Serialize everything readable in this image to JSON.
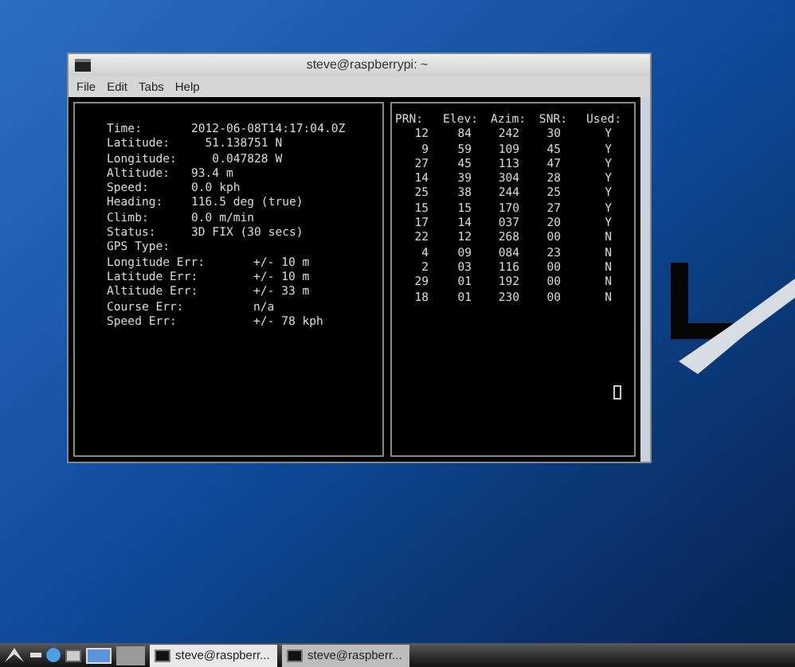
{
  "window": {
    "title": "steve@raspberrypi: ~"
  },
  "menu": [
    "File",
    "Edit",
    "Tabs",
    "Help"
  ],
  "fix": [
    {
      "label": "Time:",
      "value": "2012-06-08T14:17:04.0Z"
    },
    {
      "label": "Latitude:",
      "value": "  51.138751 N"
    },
    {
      "label": "Longitude:",
      "value": "   0.047828 W"
    },
    {
      "label": "Altitude:",
      "value": "93.4 m"
    },
    {
      "label": "Speed:",
      "value": "0.0 kph"
    },
    {
      "label": "Heading:",
      "value": "116.5 deg (true)"
    },
    {
      "label": "Climb:",
      "value": "0.0 m/min"
    },
    {
      "label": "Status:",
      "value": "3D FIX (30 secs)"
    },
    {
      "label": "GPS Type:"
    }
  ],
  "errors": [
    {
      "label": "Longitude Err:",
      "value": "+/- 10 m"
    },
    {
      "label": "Latitude Err:",
      "value": "+/- 10 m"
    },
    {
      "label": "Altitude Err:",
      "value": "+/- 33 m"
    },
    {
      "label": "Course Err:",
      "value": "n/a"
    },
    {
      "label": "Speed Err:",
      "value": "+/- 78 kph"
    }
  ],
  "satellites": {
    "columns": [
      "PRN:",
      "Elev:",
      "Azim:",
      "SNR:",
      "Used:"
    ],
    "rows": [
      [
        "12",
        "84",
        "242",
        "30",
        "Y"
      ],
      [
        "9",
        "59",
        "109",
        "45",
        "Y"
      ],
      [
        "27",
        "45",
        "113",
        "47",
        "Y"
      ],
      [
        "14",
        "39",
        "304",
        "28",
        "Y"
      ],
      [
        "25",
        "38",
        "244",
        "25",
        "Y"
      ],
      [
        "15",
        "15",
        "170",
        "27",
        "Y"
      ],
      [
        "17",
        "14",
        "037",
        "20",
        "Y"
      ],
      [
        "22",
        "12",
        "268",
        "00",
        "N"
      ],
      [
        "4",
        "09",
        "084",
        "23",
        "N"
      ],
      [
        "2",
        "03",
        "116",
        "00",
        "N"
      ],
      [
        "29",
        "01",
        "192",
        "00",
        "N"
      ],
      [
        "18",
        "01",
        "230",
        "00",
        "N"
      ]
    ]
  },
  "taskbar": {
    "tasks": [
      {
        "label": "steve@raspberr...",
        "selected": true
      },
      {
        "label": "steve@raspberr...",
        "selected": false
      }
    ]
  }
}
